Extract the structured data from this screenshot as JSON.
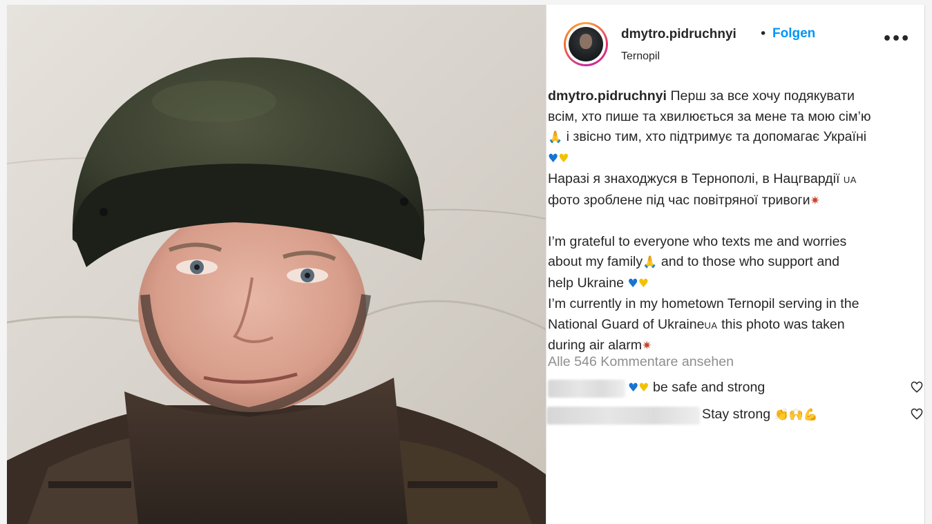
{
  "post": {
    "username": "dmytro.pidruchnyi",
    "separator": "•",
    "follow_label": "Folgen",
    "location": "Ternopil",
    "more_label": "•••"
  },
  "caption": {
    "user": "dmytro.pidruchnyi",
    "ua_line1": "Перш за все хочу подякувати",
    "ua_line2": "всім, хто пише та хвилюється за мене та мою сім’ю",
    "ua_line3": "і звісно тим, хто підтримує та допомагає Україні",
    "ua_line4": "Наразі я знаходжуся в Тернополі, в Нацгвардії",
    "ua_flag_1": "UA",
    "ua_line5": "фото зроблене під час повітряної тривоги",
    "en_line1": "I’m grateful to everyone who texts me and worries",
    "en_line2a": "about my family",
    "en_line2b": "and to those who support and",
    "en_line3": "help Ukraine",
    "en_line4": "I’m currently in my hometown Ternopil serving in the",
    "en_line5a": "National Guard of Ukraine",
    "en_flag_2": "UA",
    "en_line5b": "this photo was taken",
    "en_line6": "during air alarm"
  },
  "icons": {
    "pray": "🙏",
    "blue_heart": "♥",
    "yellow_heart": "♥",
    "anger": "✷",
    "clap": "👏",
    "raised_hands": "🙌",
    "muscle": "💪"
  },
  "colors": {
    "follow": "#0095f6",
    "text": "#262626",
    "muted": "#8e8e8e",
    "blue_heart": "#1873d3",
    "yellow_heart": "#f2c200"
  },
  "comments_link": "Alle 546 Kommentare ansehen",
  "comments": [
    {
      "text": "be safe and strong"
    },
    {
      "text": "Stay strong"
    }
  ]
}
